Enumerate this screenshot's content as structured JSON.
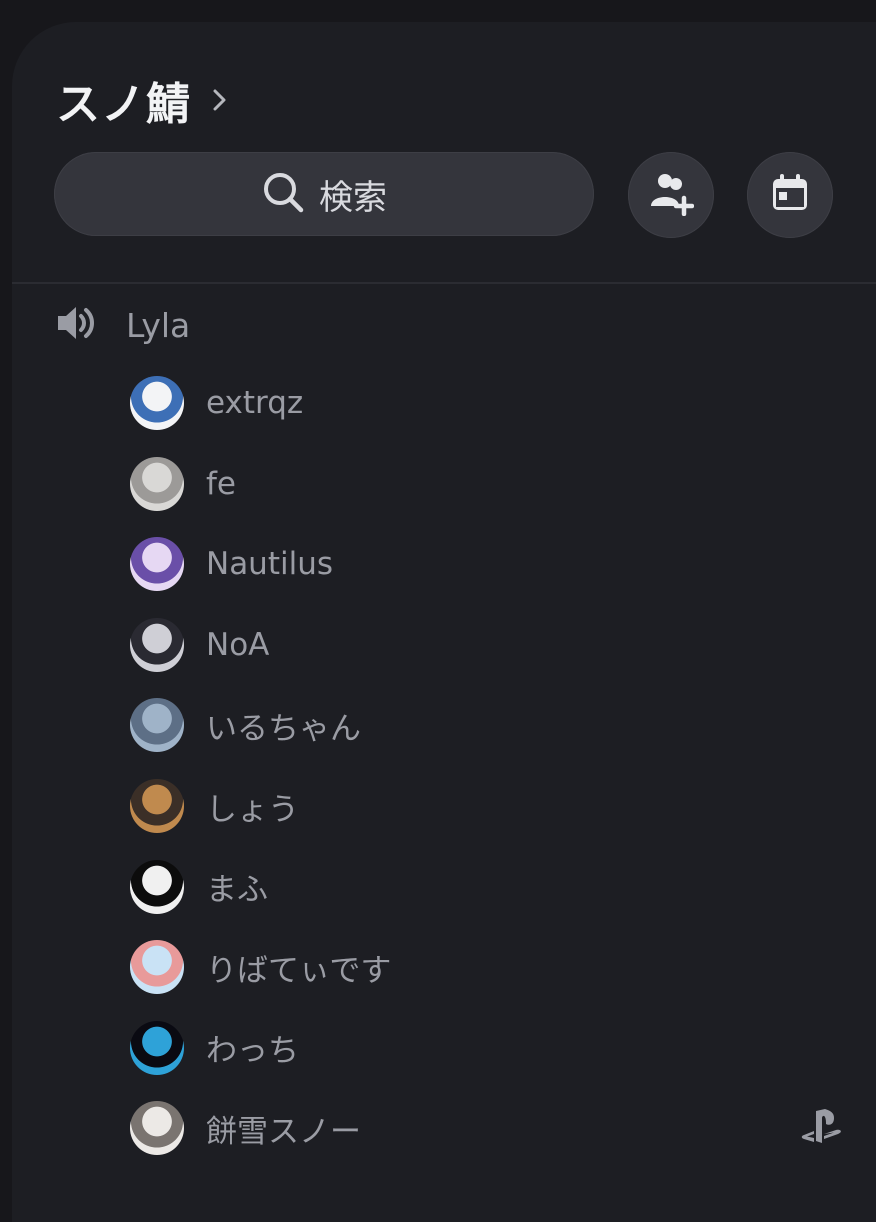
{
  "server": {
    "name": "スノ鯖"
  },
  "search": {
    "label": "検索"
  },
  "voice_channel": {
    "name": "Lyla",
    "members": [
      {
        "name": "extrqz",
        "avatar": [
          "#f3f4f6",
          "#3d6fb6"
        ]
      },
      {
        "name": "fe",
        "avatar": [
          "#d9d8d6",
          "#9c9a98"
        ]
      },
      {
        "name": "Nautilus",
        "avatar": [
          "#e6d8f3",
          "#6a4fa8"
        ]
      },
      {
        "name": "NoA",
        "avatar": [
          "#cfcfd6",
          "#2a2a32"
        ]
      },
      {
        "name": "いるちゃん",
        "avatar": [
          "#9fb3c8",
          "#5d6f86"
        ]
      },
      {
        "name": "しょう",
        "avatar": [
          "#c08a4e",
          "#3b2f27"
        ]
      },
      {
        "name": "まふ",
        "avatar": [
          "#f0f0f0",
          "#0c0c0c"
        ]
      },
      {
        "name": "りばてぃです",
        "avatar": [
          "#c9e2f5",
          "#e89a9a"
        ]
      },
      {
        "name": "わっち",
        "avatar": [
          "#2ea2d8",
          "#0a0a12"
        ]
      },
      {
        "name": "餅雪スノー",
        "avatar": [
          "#ece9e6",
          "#7a7470"
        ],
        "activity_icon": "playstation-icon"
      }
    ]
  },
  "colors": {
    "panel": "#1d1e23",
    "button": "#34353c",
    "muted_text": "#9a9ca4"
  }
}
